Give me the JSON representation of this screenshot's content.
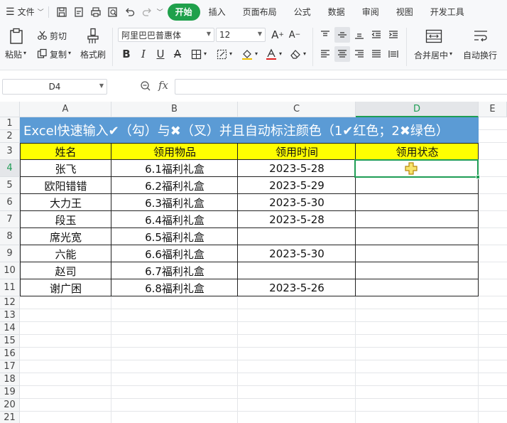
{
  "menubar": {
    "file_label": "文件",
    "tabs": [
      {
        "label": "开始",
        "active": true
      },
      {
        "label": "插入"
      },
      {
        "label": "页面布局"
      },
      {
        "label": "公式"
      },
      {
        "label": "数据"
      },
      {
        "label": "审阅"
      },
      {
        "label": "视图"
      },
      {
        "label": "开发工具"
      }
    ]
  },
  "ribbon": {
    "paste_label": "粘贴",
    "cut_label": "剪切",
    "copy_label": "复制",
    "format_painter_label": "格式刷",
    "font_name": "阿里巴巴普惠体",
    "font_size": "12",
    "merge_label": "合并居中",
    "wrap_label": "自动换行"
  },
  "formula_bar": {
    "cell_ref": "D4",
    "fx_label": "fx",
    "formula": ""
  },
  "columns": [
    "A",
    "B",
    "C",
    "D",
    "E"
  ],
  "rows": [
    "1",
    "2",
    "3",
    "4",
    "5",
    "6",
    "7",
    "8",
    "9",
    "10",
    "11",
    "12",
    "13",
    "14",
    "15",
    "16",
    "17",
    "18",
    "19",
    "20",
    "21"
  ],
  "sheet": {
    "title": "Excel快速输入✔（勾）与✖（叉）并且自动标注颜色（1✔红色；2✖绿色）",
    "headers": [
      "姓名",
      "领用物品",
      "领用时间",
      "领用状态"
    ],
    "records": [
      {
        "name": "张飞",
        "item": "6.1福利礼盒",
        "date": "2023-5-28",
        "status": ""
      },
      {
        "name": "欧阳错错",
        "item": "6.2福利礼盒",
        "date": "2023-5-29",
        "status": ""
      },
      {
        "name": "大力王",
        "item": "6.3福利礼盒",
        "date": "2023-5-30",
        "status": ""
      },
      {
        "name": "段玉",
        "item": "6.4福利礼盒",
        "date": "2023-5-28",
        "status": ""
      },
      {
        "name": "席光宽",
        "item": "6.5福利礼盒",
        "date": "",
        "status": ""
      },
      {
        "name": "六能",
        "item": "6.6福利礼盒",
        "date": "2023-5-30",
        "status": ""
      },
      {
        "name": "赵司",
        "item": "6.7福利礼盒",
        "date": "",
        "status": ""
      },
      {
        "name": "谢广困",
        "item": "6.8福利礼盒",
        "date": "2023-5-26",
        "status": ""
      }
    ]
  },
  "colors": {
    "accent": "#1fa04b",
    "title_fill": "#5b9bd5",
    "header_fill": "#ffff00",
    "selection": "#1f9d55"
  }
}
